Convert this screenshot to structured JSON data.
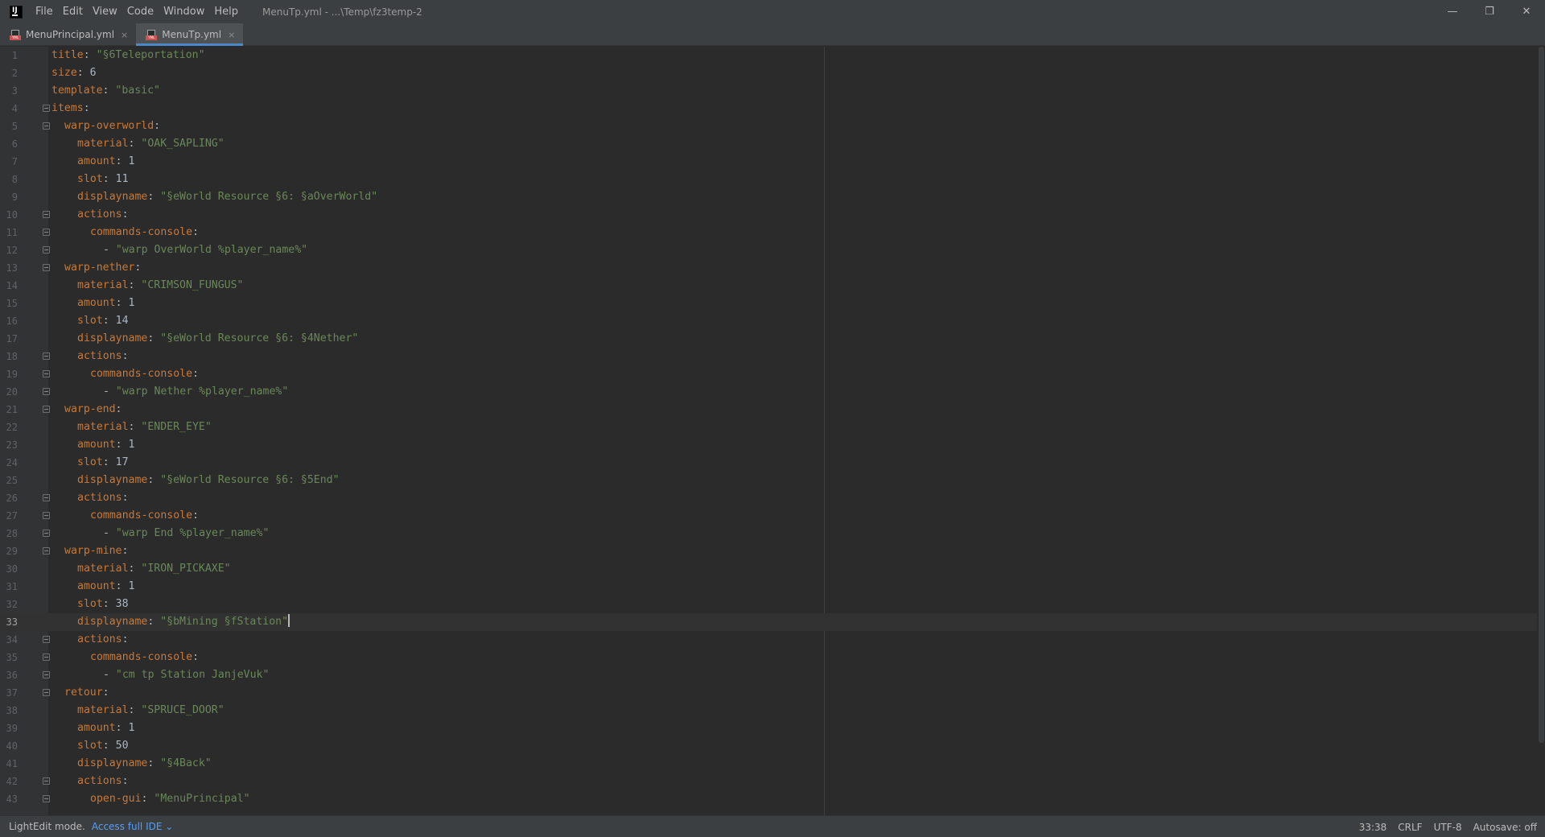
{
  "titlebar": {
    "logo": "IJ",
    "menu": [
      "File",
      "Edit",
      "View",
      "Code",
      "Window",
      "Help"
    ],
    "window_title": "MenuTp.yml - ...\\Temp\\fz3temp-2",
    "controls": {
      "minimize": "—",
      "restore": "❐",
      "close": "✕"
    }
  },
  "tabs": [
    {
      "label": "MenuPrincipal.yml",
      "active": false,
      "close": "×",
      "icon": "yaml-file-icon"
    },
    {
      "label": "MenuTp.yml",
      "active": true,
      "close": "×",
      "icon": "yaml-file-icon"
    }
  ],
  "editor": {
    "current_line": 33,
    "lines": [
      {
        "n": "1",
        "indent": 0,
        "key": "title",
        "sep": ": ",
        "val": "\"§6Teleportation\"",
        "vtype": "str",
        "fold": false
      },
      {
        "n": "2",
        "indent": 0,
        "key": "size",
        "sep": ": ",
        "val": "6",
        "vtype": "num",
        "fold": false
      },
      {
        "n": "3",
        "indent": 0,
        "key": "template",
        "sep": ": ",
        "val": "\"basic\"",
        "vtype": "str",
        "fold": false
      },
      {
        "n": "4",
        "indent": 0,
        "key": "items",
        "sep": ":",
        "val": "",
        "vtype": "none",
        "fold": true
      },
      {
        "n": "5",
        "indent": 2,
        "key": "warp-overworld",
        "sep": ":",
        "val": "",
        "vtype": "none",
        "fold": true
      },
      {
        "n": "6",
        "indent": 4,
        "key": "material",
        "sep": ": ",
        "val": "\"OAK_SAPLING\"",
        "vtype": "str",
        "fold": false
      },
      {
        "n": "7",
        "indent": 4,
        "key": "amount",
        "sep": ": ",
        "val": "1",
        "vtype": "num",
        "fold": false
      },
      {
        "n": "8",
        "indent": 4,
        "key": "slot",
        "sep": ": ",
        "val": "11",
        "vtype": "num",
        "fold": false
      },
      {
        "n": "9",
        "indent": 4,
        "key": "displayname",
        "sep": ": ",
        "val": "\"§eWorld Resource §6: §aOverWorld\"",
        "vtype": "str",
        "fold": false
      },
      {
        "n": "10",
        "indent": 4,
        "key": "actions",
        "sep": ":",
        "val": "",
        "vtype": "none",
        "fold": true
      },
      {
        "n": "11",
        "indent": 6,
        "key": "commands-console",
        "sep": ":",
        "val": "",
        "vtype": "none",
        "fold": true
      },
      {
        "n": "12",
        "indent": 8,
        "key": "",
        "sep": "- ",
        "val": "\"warp OverWorld %player_name%\"",
        "vtype": "str",
        "fold": true
      },
      {
        "n": "13",
        "indent": 2,
        "key": "warp-nether",
        "sep": ":",
        "val": "",
        "vtype": "none",
        "fold": true
      },
      {
        "n": "14",
        "indent": 4,
        "key": "material",
        "sep": ": ",
        "val": "\"CRIMSON_FUNGUS\"",
        "vtype": "str",
        "fold": false
      },
      {
        "n": "15",
        "indent": 4,
        "key": "amount",
        "sep": ": ",
        "val": "1",
        "vtype": "num",
        "fold": false
      },
      {
        "n": "16",
        "indent": 4,
        "key": "slot",
        "sep": ": ",
        "val": "14",
        "vtype": "num",
        "fold": false
      },
      {
        "n": "17",
        "indent": 4,
        "key": "displayname",
        "sep": ": ",
        "val": "\"§eWorld Resource §6: §4Nether\"",
        "vtype": "str",
        "fold": false
      },
      {
        "n": "18",
        "indent": 4,
        "key": "actions",
        "sep": ":",
        "val": "",
        "vtype": "none",
        "fold": true
      },
      {
        "n": "19",
        "indent": 6,
        "key": "commands-console",
        "sep": ":",
        "val": "",
        "vtype": "none",
        "fold": true
      },
      {
        "n": "20",
        "indent": 8,
        "key": "",
        "sep": "- ",
        "val": "\"warp Nether %player_name%\"",
        "vtype": "str",
        "fold": true
      },
      {
        "n": "21",
        "indent": 2,
        "key": "warp-end",
        "sep": ":",
        "val": "",
        "vtype": "none",
        "fold": true
      },
      {
        "n": "22",
        "indent": 4,
        "key": "material",
        "sep": ": ",
        "val": "\"ENDER_EYE\"",
        "vtype": "str",
        "fold": false
      },
      {
        "n": "23",
        "indent": 4,
        "key": "amount",
        "sep": ": ",
        "val": "1",
        "vtype": "num",
        "fold": false
      },
      {
        "n": "24",
        "indent": 4,
        "key": "slot",
        "sep": ": ",
        "val": "17",
        "vtype": "num",
        "fold": false
      },
      {
        "n": "25",
        "indent": 4,
        "key": "displayname",
        "sep": ": ",
        "val": "\"§eWorld Resource §6: §5End\"",
        "vtype": "str",
        "fold": false
      },
      {
        "n": "26",
        "indent": 4,
        "key": "actions",
        "sep": ":",
        "val": "",
        "vtype": "none",
        "fold": true
      },
      {
        "n": "27",
        "indent": 6,
        "key": "commands-console",
        "sep": ":",
        "val": "",
        "vtype": "none",
        "fold": true
      },
      {
        "n": "28",
        "indent": 8,
        "key": "",
        "sep": "- ",
        "val": "\"warp End %player_name%\"",
        "vtype": "str",
        "fold": true
      },
      {
        "n": "29",
        "indent": 2,
        "key": "warp-mine",
        "sep": ":",
        "val": "",
        "vtype": "none",
        "fold": true
      },
      {
        "n": "30",
        "indent": 4,
        "key": "material",
        "sep": ": ",
        "val": "\"IRON_PICKAXE\"",
        "vtype": "str",
        "fold": false
      },
      {
        "n": "31",
        "indent": 4,
        "key": "amount",
        "sep": ": ",
        "val": "1",
        "vtype": "num",
        "fold": false
      },
      {
        "n": "32",
        "indent": 4,
        "key": "slot",
        "sep": ": ",
        "val": "38",
        "vtype": "num",
        "fold": false
      },
      {
        "n": "33",
        "indent": 4,
        "key": "displayname",
        "sep": ": ",
        "val": "\"§bMining §fStation\"",
        "vtype": "str",
        "fold": false
      },
      {
        "n": "34",
        "indent": 4,
        "key": "actions",
        "sep": ":",
        "val": "",
        "vtype": "none",
        "fold": true
      },
      {
        "n": "35",
        "indent": 6,
        "key": "commands-console",
        "sep": ":",
        "val": "",
        "vtype": "none",
        "fold": true
      },
      {
        "n": "36",
        "indent": 8,
        "key": "",
        "sep": "- ",
        "val": "\"cm tp Station JanjeVuk\"",
        "vtype": "str",
        "fold": true
      },
      {
        "n": "37",
        "indent": 2,
        "key": "retour",
        "sep": ":",
        "val": "",
        "vtype": "none",
        "fold": true
      },
      {
        "n": "38",
        "indent": 4,
        "key": "material",
        "sep": ": ",
        "val": "\"SPRUCE_DOOR\"",
        "vtype": "str",
        "fold": false
      },
      {
        "n": "39",
        "indent": 4,
        "key": "amount",
        "sep": ": ",
        "val": "1",
        "vtype": "num",
        "fold": false
      },
      {
        "n": "40",
        "indent": 4,
        "key": "slot",
        "sep": ": ",
        "val": "50",
        "vtype": "num",
        "fold": false
      },
      {
        "n": "41",
        "indent": 4,
        "key": "displayname",
        "sep": ": ",
        "val": "\"§4Back\"",
        "vtype": "str",
        "fold": false
      },
      {
        "n": "42",
        "indent": 4,
        "key": "actions",
        "sep": ":",
        "val": "",
        "vtype": "none",
        "fold": true
      },
      {
        "n": "43",
        "indent": 6,
        "key": "open-gui",
        "sep": ": ",
        "val": "\"MenuPrincipal\"",
        "vtype": "str",
        "fold": true
      }
    ]
  },
  "statusbar": {
    "mode": "LightEdit mode.",
    "link": "Access full IDE ⌄",
    "position": "33:38",
    "line_ending": "CRLF",
    "encoding": "UTF-8",
    "autosave": "Autosave: off"
  },
  "colors": {
    "key": "#cc7832",
    "string": "#6a8759",
    "number": "#a9b7c6",
    "accent": "#4a88c7"
  }
}
